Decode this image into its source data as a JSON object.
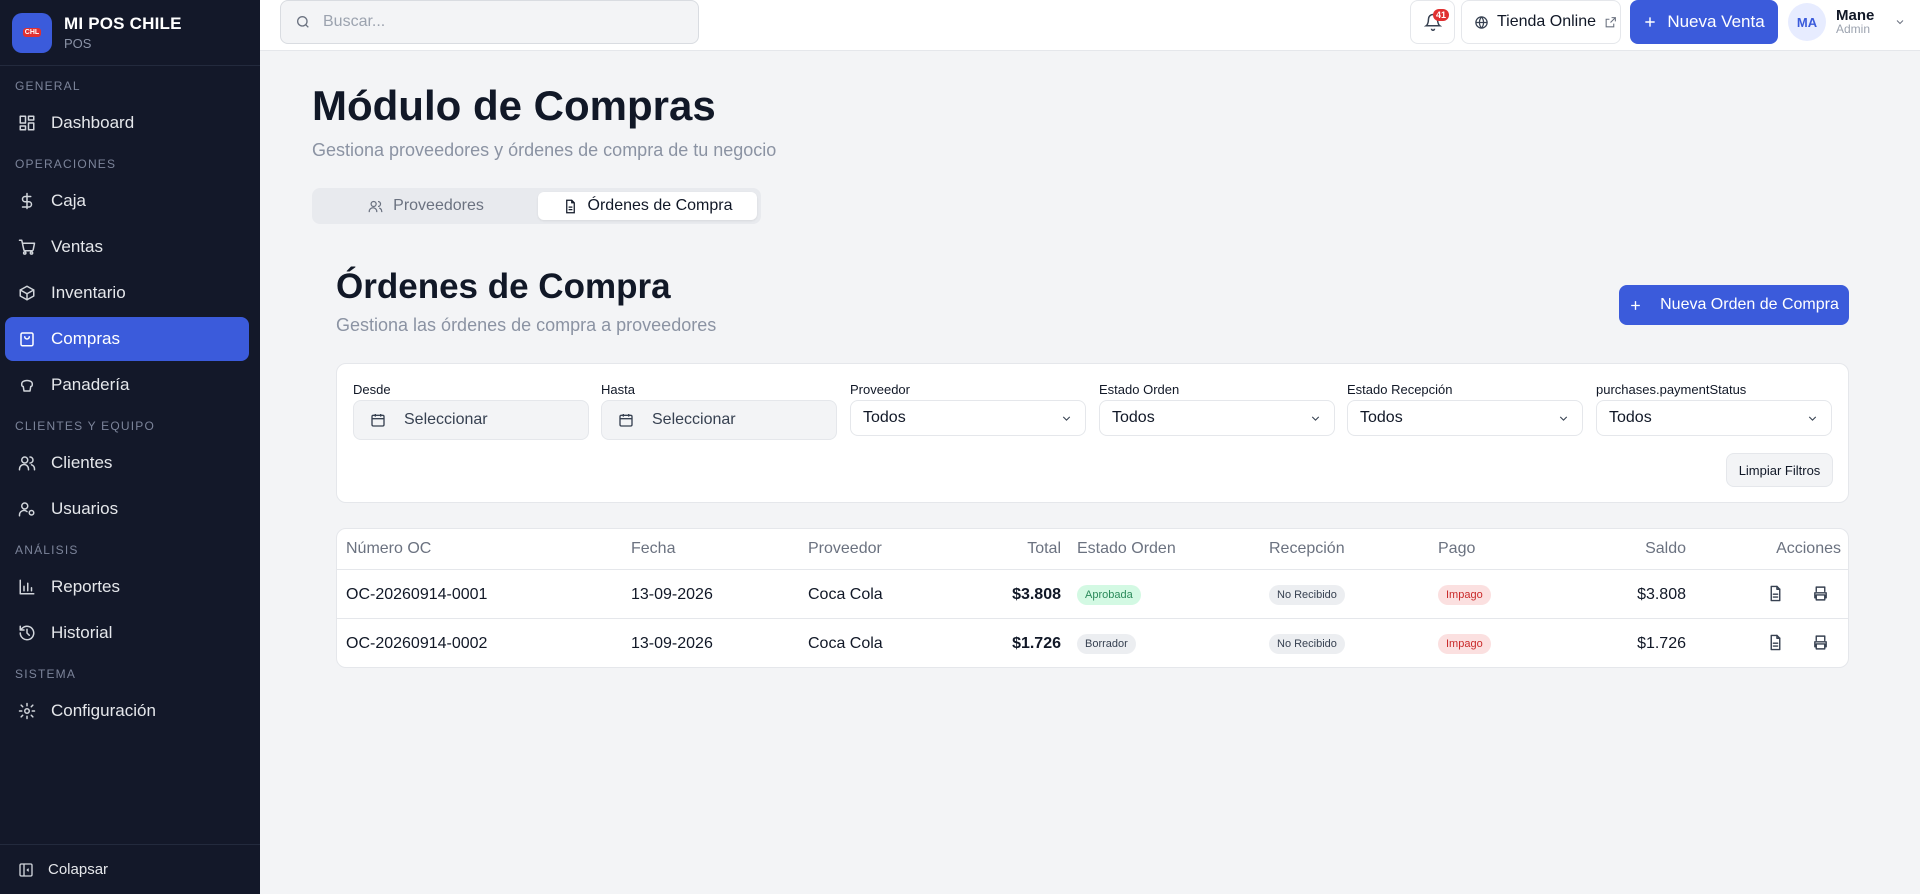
{
  "brand": {
    "name": "MI POS CHILE",
    "sub": "POS",
    "logo_text": "CHL"
  },
  "sidebar": {
    "sections": [
      "GENERAL",
      "OPERACIONES",
      "CLIENTES Y EQUIPO",
      "ANÁLISIS",
      "SISTEMA"
    ],
    "items": [
      {
        "label": "Dashboard",
        "icon": "dashboard-icon"
      },
      {
        "label": "Caja",
        "icon": "dollar-icon"
      },
      {
        "label": "Ventas",
        "icon": "cart-icon"
      },
      {
        "label": "Inventario",
        "icon": "box-icon"
      },
      {
        "label": "Compras",
        "icon": "shopping-bag-icon",
        "active": true
      },
      {
        "label": "Panadería",
        "icon": "bread-icon"
      },
      {
        "label": "Clientes",
        "icon": "users-icon"
      },
      {
        "label": "Usuarios",
        "icon": "user-cog-icon"
      },
      {
        "label": "Reportes",
        "icon": "chart-icon"
      },
      {
        "label": "Historial",
        "icon": "history-icon"
      },
      {
        "label": "Configuración",
        "icon": "gear-icon"
      }
    ],
    "collapse_label": "Colapsar"
  },
  "topbar": {
    "search_placeholder": "Buscar...",
    "notifications_count": "41",
    "tienda_label": "Tienda Online",
    "nueva_venta_label": "Nueva Venta",
    "user": {
      "initials": "MA",
      "name": "Mane",
      "role": "Admin"
    }
  },
  "page": {
    "title": "Módulo de Compras",
    "subtitle": "Gestiona proveedores y órdenes de compra de tu negocio",
    "tabs": [
      {
        "label": "Proveedores",
        "active": false
      },
      {
        "label": "Órdenes de Compra",
        "active": true
      }
    ]
  },
  "orders": {
    "title": "Órdenes de Compra",
    "subtitle": "Gestiona las órdenes de compra a proveedores",
    "new_button": "Nueva Orden de Compra",
    "filters": {
      "desde": {
        "label": "Desde",
        "value": "Seleccionar"
      },
      "hasta": {
        "label": "Hasta",
        "value": "Seleccionar"
      },
      "proveedor": {
        "label": "Proveedor",
        "value": "Todos"
      },
      "estado_orden": {
        "label": "Estado Orden",
        "value": "Todos"
      },
      "estado_recepcion": {
        "label": "Estado Recepción",
        "value": "Todos"
      },
      "payment_status": {
        "label": "purchases.paymentStatus",
        "value": "Todos"
      },
      "clear_label": "Limpiar Filtros"
    },
    "columns": [
      "Número OC",
      "Fecha",
      "Proveedor",
      "Total",
      "Estado Orden",
      "Recepción",
      "Pago",
      "Saldo",
      "Acciones"
    ],
    "rows": [
      {
        "numero": "OC-20260914-0001",
        "fecha": "13-09-2026",
        "proveedor": "Coca Cola",
        "total": "$3.808",
        "estado": "Aprobada",
        "estado_color": "#2b8a5a",
        "recepcion": "No Recibido",
        "pago": "Impago",
        "saldo": "$3.808"
      },
      {
        "numero": "OC-20260914-0002",
        "fecha": "13-09-2026",
        "proveedor": "Coca Cola",
        "total": "$1.726",
        "estado": "Borrador",
        "estado_color": "#374151",
        "recepcion": "No Recibido",
        "pago": "Impago",
        "saldo": "$1.726"
      }
    ]
  },
  "colors": {
    "accent": "#3b5bdb",
    "sidebar_bg": "#131829",
    "danger": "#e03131"
  }
}
